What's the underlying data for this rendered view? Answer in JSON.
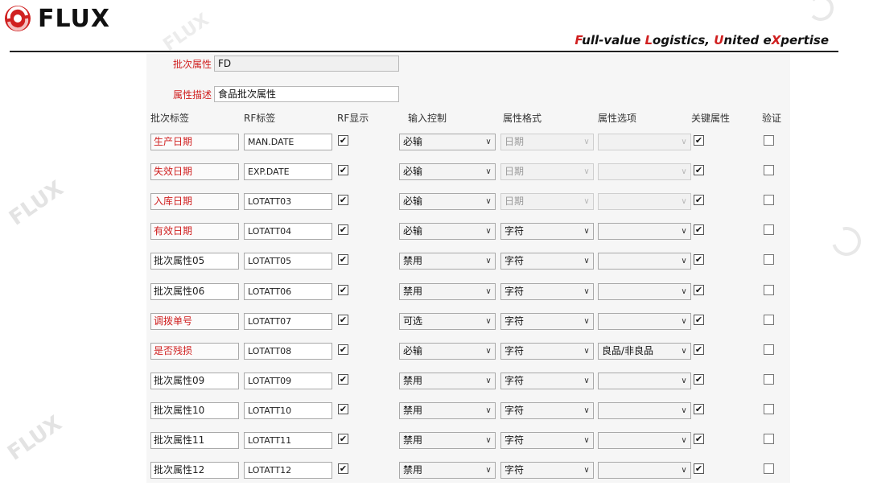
{
  "brand": {
    "name": "FLUX",
    "slogan": [
      {
        "t": "F",
        "accent": true
      },
      {
        "t": "ull-value ",
        "accent": false
      },
      {
        "t": "L",
        "accent": true
      },
      {
        "t": "ogistics, ",
        "accent": false
      },
      {
        "t": "U",
        "accent": true
      },
      {
        "t": "nited e",
        "accent": false
      },
      {
        "t": "X",
        "accent": true
      },
      {
        "t": "pertise",
        "accent": false
      }
    ],
    "accent_color": "#d02020"
  },
  "watermark_text": "FLUX",
  "form": {
    "batch_attr_label": "批次属性",
    "batch_attr_value": "FD",
    "attr_desc_label": "属性描述",
    "attr_desc_value": "食品批次属性"
  },
  "columns": {
    "batch_label": "批次标签",
    "rf_label": "RF标签",
    "rf_display": "RF显示",
    "input_control": "输入控制",
    "attr_format": "属性格式",
    "attr_option": "属性选项",
    "key_attr": "关键属性",
    "verify": "验证"
  },
  "rows": [
    {
      "label": "生产日期",
      "required": true,
      "rf": "MAN.DATE",
      "rf_show": true,
      "control": "必输",
      "format": "日期",
      "format_disabled": true,
      "option": "",
      "key": true,
      "verify": false
    },
    {
      "label": "失效日期",
      "required": true,
      "rf": "EXP.DATE",
      "rf_show": true,
      "control": "必输",
      "format": "日期",
      "format_disabled": true,
      "option": "",
      "key": true,
      "verify": false
    },
    {
      "label": "入库日期",
      "required": true,
      "rf": "LOTATT03",
      "rf_show": true,
      "control": "必输",
      "format": "日期",
      "format_disabled": true,
      "option": "",
      "key": true,
      "verify": false
    },
    {
      "label": "有效日期",
      "required": true,
      "rf": "LOTATT04",
      "rf_show": true,
      "control": "必输",
      "format": "字符",
      "format_disabled": false,
      "option": "",
      "key": true,
      "verify": false
    },
    {
      "label": "批次属性05",
      "required": false,
      "rf": "LOTATT05",
      "rf_show": true,
      "control": "禁用",
      "format": "字符",
      "format_disabled": false,
      "option": "",
      "key": true,
      "verify": false
    },
    {
      "label": "批次属性06",
      "required": false,
      "rf": "LOTATT06",
      "rf_show": true,
      "control": "禁用",
      "format": "字符",
      "format_disabled": false,
      "option": "",
      "key": true,
      "verify": false
    },
    {
      "label": "调拨单号",
      "required": true,
      "rf": "LOTATT07",
      "rf_show": true,
      "control": "可选",
      "format": "字符",
      "format_disabled": false,
      "option": "",
      "key": true,
      "verify": false
    },
    {
      "label": "是否残损",
      "required": true,
      "rf": "LOTATT08",
      "rf_show": true,
      "control": "必输",
      "format": "字符",
      "format_disabled": false,
      "option": "良品/非良品",
      "key": true,
      "verify": false
    },
    {
      "label": "批次属性09",
      "required": false,
      "rf": "LOTATT09",
      "rf_show": true,
      "control": "禁用",
      "format": "字符",
      "format_disabled": false,
      "option": "",
      "key": true,
      "verify": false
    },
    {
      "label": "批次属性10",
      "required": false,
      "rf": "LOTATT10",
      "rf_show": true,
      "control": "禁用",
      "format": "字符",
      "format_disabled": false,
      "option": "",
      "key": true,
      "verify": false
    },
    {
      "label": "批次属性11",
      "required": false,
      "rf": "LOTATT11",
      "rf_show": true,
      "control": "禁用",
      "format": "字符",
      "format_disabled": false,
      "option": "",
      "key": true,
      "verify": false
    },
    {
      "label": "批次属性12",
      "required": false,
      "rf": "LOTATT12",
      "rf_show": true,
      "control": "禁用",
      "format": "字符",
      "format_disabled": false,
      "option": "",
      "key": true,
      "verify": false
    }
  ]
}
